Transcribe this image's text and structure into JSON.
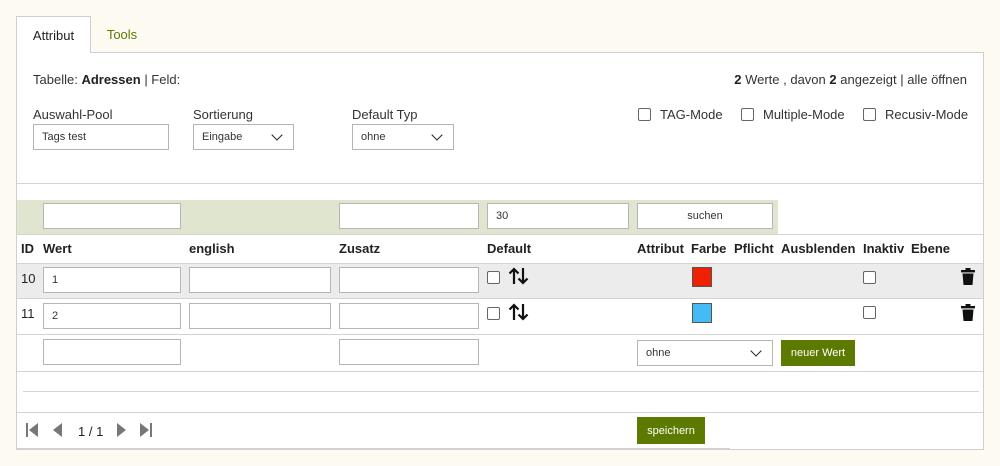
{
  "tabs": [
    {
      "label": "Attribut",
      "active": true
    },
    {
      "label": "Tools",
      "active": false
    }
  ],
  "header": {
    "table_label": "Tabelle:",
    "table_name": "Adressen",
    "field_label": "| Feld:",
    "count_total": "2",
    "count_text1": "Werte , davon",
    "count_shown": "2",
    "count_text2": "angezeigt | alle öffnen"
  },
  "settings": {
    "pool_label": "Auswahl-Pool",
    "pool_value": "Tags test",
    "sort_label": "Sortierung",
    "sort_value": "Eingabe",
    "default_type_label": "Default Typ",
    "default_type_value": "ohne",
    "modes": [
      "TAG-Mode",
      "Multiple-Mode",
      "Recusiv-Mode"
    ]
  },
  "filter": {
    "wert": "",
    "zusatz": "",
    "default": "30",
    "search_label": "suchen"
  },
  "columns": [
    "ID",
    "Wert",
    "english",
    "Zusatz",
    "Default",
    "Attribut",
    "Farbe",
    "Pflicht",
    "Ausblenden",
    "Inaktiv",
    "Ebene"
  ],
  "rows": [
    {
      "id": "10",
      "wert": "1",
      "english": "",
      "zusatz": "",
      "color": "#ee2200"
    },
    {
      "id": "11",
      "wert": "2",
      "english": "",
      "zusatz": "",
      "color": "#44bbf5"
    }
  ],
  "new_row": {
    "wert": "",
    "zusatz": "",
    "attribut_value": "ohne",
    "add_label": "neuer Wert"
  },
  "footer": {
    "page": "1 / 1",
    "save_label": "speichern"
  }
}
